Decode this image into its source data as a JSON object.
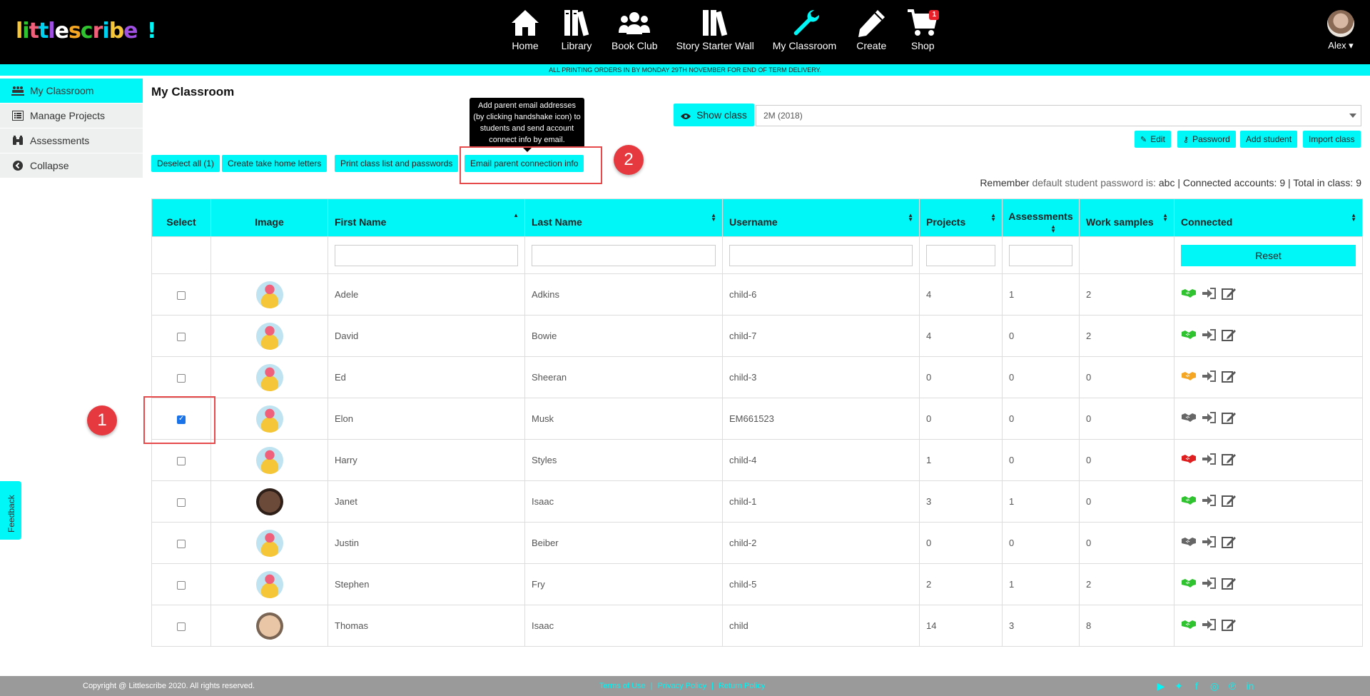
{
  "brand": {
    "logo_text": "littlescribe",
    "logo_exclaim": "!"
  },
  "nav": {
    "items": [
      {
        "label": "Home",
        "icon": "home-icon"
      },
      {
        "label": "Library",
        "icon": "library-icon"
      },
      {
        "label": "Book Club",
        "icon": "group-icon"
      },
      {
        "label": "Story Starter Wall",
        "icon": "books-icon"
      },
      {
        "label": "My Classroom",
        "icon": "wrench-icon"
      },
      {
        "label": "Create",
        "icon": "pencil-icon"
      },
      {
        "label": "Shop",
        "icon": "cart-icon"
      }
    ],
    "active": "My Classroom",
    "cart_count": "1",
    "user_name": "Alex ▾"
  },
  "banner": "ALL PRINTING ORDERS IN BY MONDAY 29TH NOVEMBER FOR END OF TERM DELIVERY.",
  "sidebar": {
    "items": [
      {
        "label": "My Classroom",
        "icon": "classroom-icon"
      },
      {
        "label": "Manage Projects",
        "icon": "list-icon"
      },
      {
        "label": "Assessments",
        "icon": "binoculars-icon"
      },
      {
        "label": "Collapse",
        "icon": "chevron-left-icon"
      }
    ]
  },
  "feedback_label": "Feedback",
  "page_title": "My Classroom",
  "tooltip": "Add parent email addresses (by clicking handshake icon) to students and send account connect info by email.",
  "actions": {
    "deselect_all": "Deselect all (1)",
    "take_home": "Create take home letters",
    "print_list": "Print class list and passwords",
    "email_parent": "Email parent connection info",
    "show_class": "Show class",
    "class_select": "2M (2018)",
    "edit": "Edit",
    "password": "Password",
    "add_student": "Add student",
    "import_class": "Import class"
  },
  "annotations": {
    "badge1": "1",
    "badge2": "2"
  },
  "info": {
    "remember": "Remember",
    "default_pw_label": "default student password is:",
    "default_pw": "abc",
    "connected_label": "| Connected accounts:",
    "connected": "9",
    "total_label": "| Total in class:",
    "total": "9"
  },
  "table": {
    "headers": {
      "select": "Select",
      "image": "Image",
      "first_name": "First Name",
      "last_name": "Last Name",
      "username": "Username",
      "projects": "Projects",
      "assessments": "Assessments",
      "work_samples": "Work samples",
      "connected": "Connected"
    },
    "reset_label": "Reset",
    "rows": [
      {
        "first": "Adele",
        "last": "Adkins",
        "username": "child-6",
        "projects": "4",
        "assessments": "1",
        "work_samples": "2",
        "checked": false,
        "avatar": "cartoon",
        "conn_color": "#2fc42f"
      },
      {
        "first": "David",
        "last": "Bowie",
        "username": "child-7",
        "projects": "4",
        "assessments": "0",
        "work_samples": "2",
        "checked": false,
        "avatar": "cartoon",
        "conn_color": "#2fc42f"
      },
      {
        "first": "Ed",
        "last": "Sheeran",
        "username": "child-3",
        "projects": "0",
        "assessments": "0",
        "work_samples": "0",
        "checked": false,
        "avatar": "cartoon",
        "conn_color": "#f5a623"
      },
      {
        "first": "Elon",
        "last": "Musk",
        "username": "EM661523",
        "projects": "0",
        "assessments": "0",
        "work_samples": "0",
        "checked": true,
        "avatar": "cartoon",
        "conn_color": "#666666"
      },
      {
        "first": "Harry",
        "last": "Styles",
        "username": "child-4",
        "projects": "1",
        "assessments": "0",
        "work_samples": "0",
        "checked": false,
        "avatar": "cartoon",
        "conn_color": "#e02020"
      },
      {
        "first": "Janet",
        "last": "Isaac",
        "username": "child-1",
        "projects": "3",
        "assessments": "1",
        "work_samples": "0",
        "checked": false,
        "avatar": "photo1",
        "conn_color": "#2fc42f"
      },
      {
        "first": "Justin",
        "last": "Beiber",
        "username": "child-2",
        "projects": "0",
        "assessments": "0",
        "work_samples": "0",
        "checked": false,
        "avatar": "cartoon",
        "conn_color": "#666666"
      },
      {
        "first": "Stephen",
        "last": "Fry",
        "username": "child-5",
        "projects": "2",
        "assessments": "1",
        "work_samples": "2",
        "checked": false,
        "avatar": "cartoon",
        "conn_color": "#2fc42f"
      },
      {
        "first": "Thomas",
        "last": "Isaac",
        "username": "child",
        "projects": "14",
        "assessments": "3",
        "work_samples": "8",
        "checked": false,
        "avatar": "photo2",
        "conn_color": "#2fc42f"
      }
    ]
  },
  "footer": {
    "copyright": "Copyright @ Littlescribe 2020. All rights reserved.",
    "links": [
      "Terms of Use",
      "Privacy Policy",
      "Return Policy"
    ],
    "social": [
      "youtube-icon",
      "twitter-icon",
      "facebook-icon",
      "instagram-icon",
      "pinterest-icon",
      "linkedin-icon"
    ]
  },
  "colors": {
    "accent": "#00f7f7",
    "nav_bg": "#000000",
    "annotation_red": "#e5393f"
  }
}
